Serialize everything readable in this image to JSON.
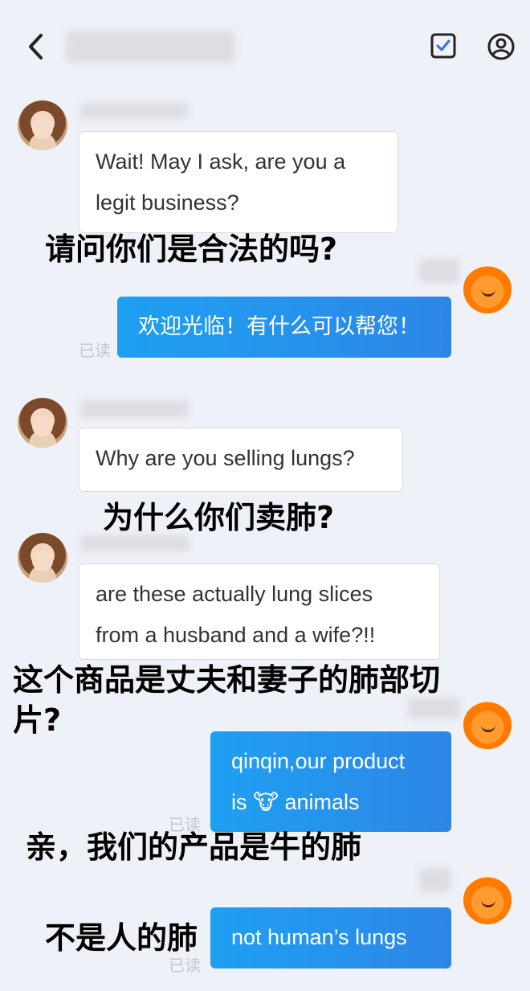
{
  "header": {
    "back_icon": "chevron-left-icon",
    "title": "",
    "task_icon": "checkbox-icon",
    "profile_icon": "person-icon",
    "accent": "#3b6fd8"
  },
  "messages": [
    {
      "side": "in",
      "text_line1": "Wait! May I ask, are you a",
      "text_line2": "legit business?"
    },
    {
      "side": "out",
      "text": "欢迎光临！有什么可以帮您！",
      "status": "已读"
    },
    {
      "side": "in",
      "text": "Why are you selling lungs?"
    },
    {
      "side": "in",
      "text_line1": "are these actually lung slices",
      "text_line2": "from a husband and a wife?!!"
    },
    {
      "side": "out",
      "text_line1": "qinqin,our product",
      "text_line2_a": "is ",
      "emoji": "🐮",
      "text_line2_b": " animals",
      "status": "已读"
    },
    {
      "side": "out",
      "text": "not human’s lungs",
      "status": "已读"
    }
  ],
  "captions": {
    "c1": "请问你们是合法的吗?",
    "c2": "为什么你们卖肺?",
    "c3_line1": "这个商品是丈夫和妻子的肺部切",
    "c3_line2": "片?",
    "c4": "亲，我们的产品是牛的肺",
    "c5": "不是人的肺"
  },
  "colors": {
    "bubble_out": "#2196f3",
    "bubble_in": "#ffffff",
    "background": "#eef1f7"
  }
}
